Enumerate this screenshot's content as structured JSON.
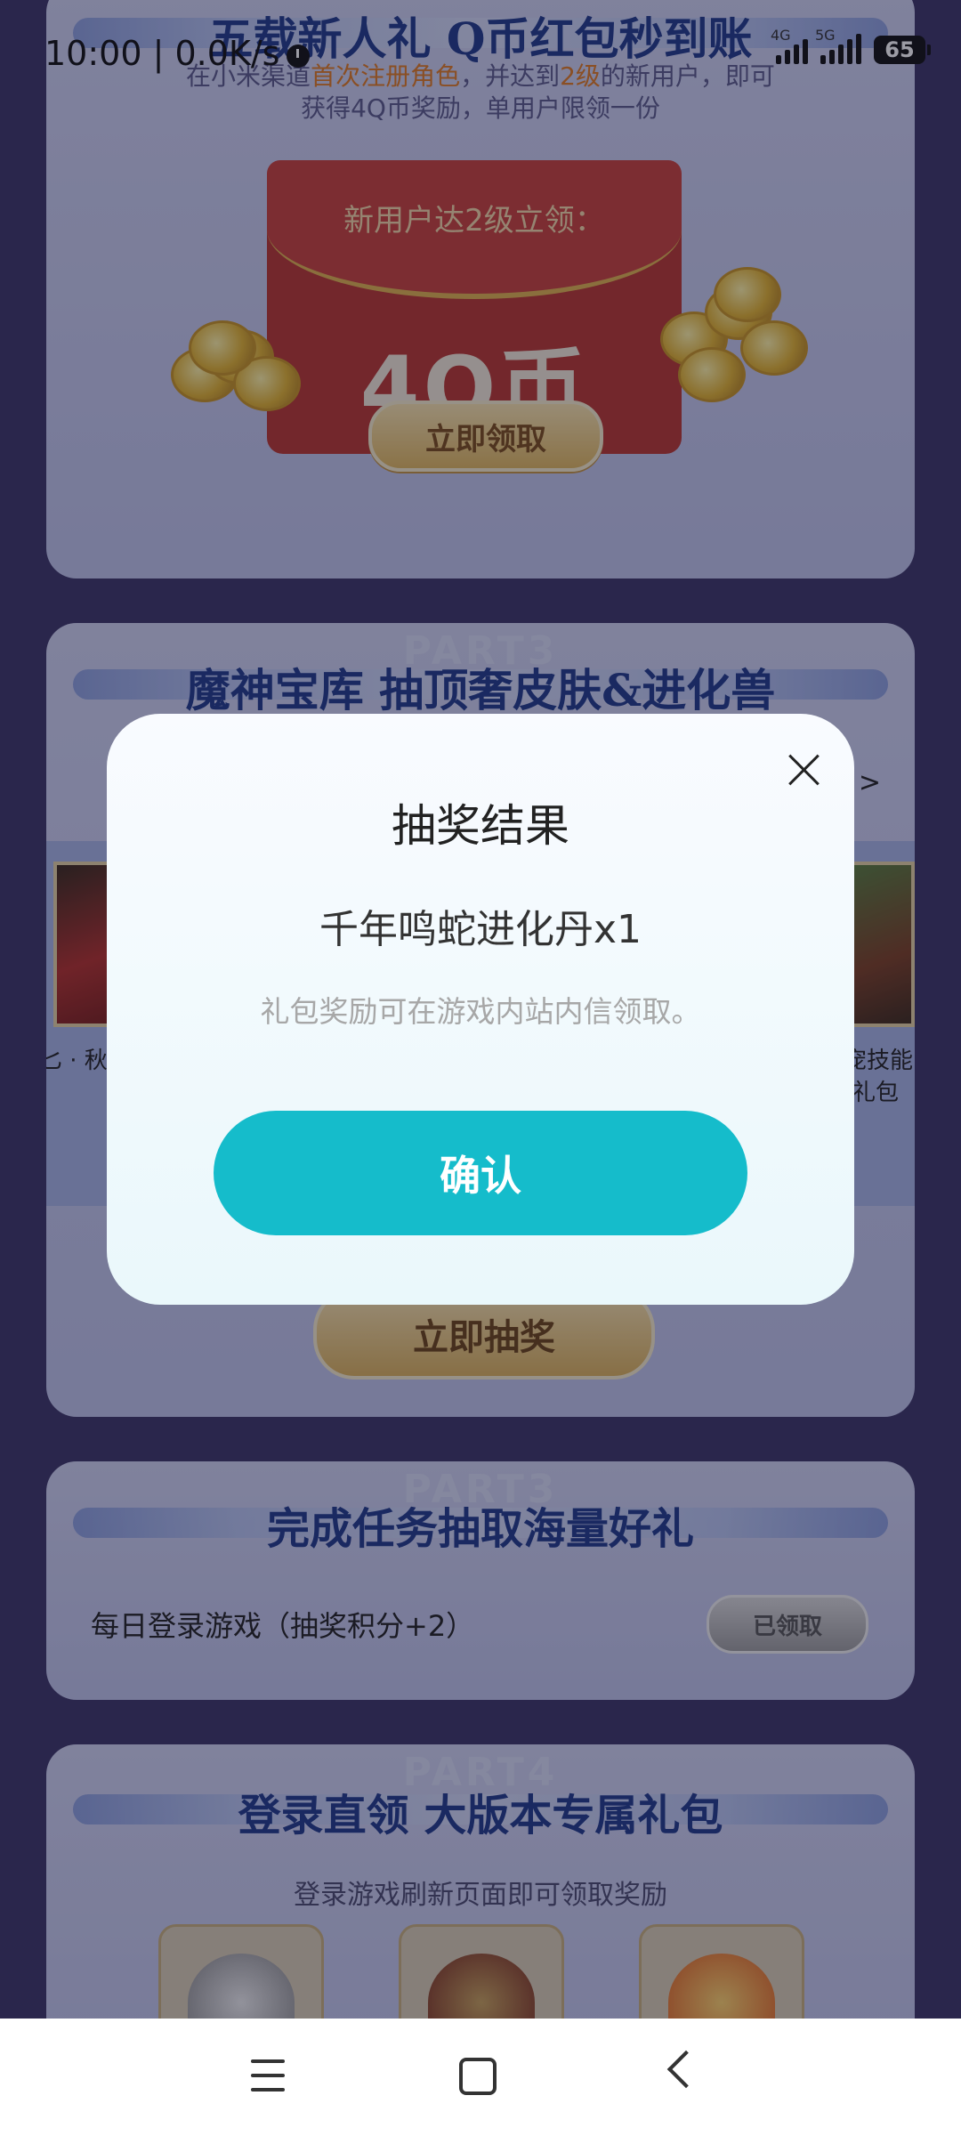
{
  "status_bar": {
    "time": "10:00 | 0.0K/s",
    "network_1": "4G",
    "network_2": "5G",
    "battery": "65"
  },
  "card1": {
    "title": "五载新人礼 Q币红包秒到账",
    "desc_prefix": "在小米渠道",
    "desc_highlight1": "首次注册角色",
    "desc_middle": "，并达到",
    "desc_highlight2": "2级",
    "desc_suffix": "的新用户，即可",
    "desc_line2": "获得4Q币奖励，单用户限领一份",
    "envelope_label": "新用户达2级立领：",
    "envelope_amount": "4Q币",
    "claim_button": "立即领取"
  },
  "card2": {
    "title": "魔神宝库 抽顶奢皮肤&进化兽",
    "ghost": "PART3",
    "more": ">",
    "left_label": "匕 · 秋",
    "right_label_1": "宠技能",
    "right_label_2": "礼包",
    "draw_button": "立即抽奖"
  },
  "card3": {
    "title": "完成任务抽取海量好礼",
    "ghost": "PART3",
    "task_label": "每日登录游戏（抽奖积分+2）",
    "task_button": "已领取"
  },
  "card4": {
    "title": "登录直领 大版本专属礼包",
    "ghost": "PART4",
    "subtitle": "登录游戏刷新页面即可领取奖励"
  },
  "modal": {
    "title": "抽奖结果",
    "prize": "千年鸣蛇进化丹x1",
    "note": "礼包奖励可在游戏内站内信领取。",
    "confirm": "确认"
  },
  "colors": {
    "accent_teal": "#15bccb",
    "title_blue": "#1f3a8a",
    "highlight_orange": "#e07a22",
    "page_bg": "#3b3466"
  }
}
